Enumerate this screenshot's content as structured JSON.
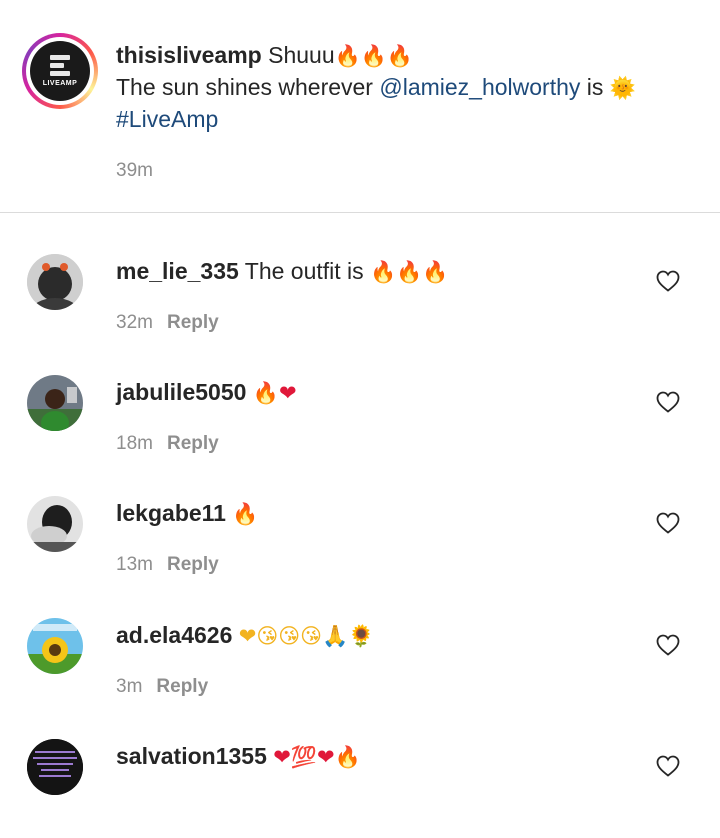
{
  "caption": {
    "username": "thisisliveamp",
    "line1_text": "Shuuu",
    "line1_emoji": "🔥🔥🔥",
    "line2_text": "The sun shines wherever",
    "mention": "@lamiez_holworthy",
    "line2_after": "is",
    "line2_emoji": "🌞",
    "hashtag": "#LiveAmp",
    "time": "39m",
    "avatar_logo_text": "LIVEAMP"
  },
  "comments": [
    {
      "username": "me_lie_335",
      "text": "The outfit is",
      "emoji": "🔥🔥🔥",
      "time": "32m",
      "reply": "Reply"
    },
    {
      "username": "jabulile5050",
      "text": "",
      "emoji": "🔥❤",
      "time": "18m",
      "reply": "Reply"
    },
    {
      "username": "lekgabe11",
      "text": "",
      "emoji": "🔥",
      "time": "13m",
      "reply": "Reply"
    },
    {
      "username": "ad.ela4626",
      "text": "",
      "emoji": "❤😘😘😘🙏🌻",
      "time": "3m",
      "reply": "Reply"
    },
    {
      "username": "salvation1355",
      "text": "",
      "emoji": "❤💯❤🔥",
      "time": "",
      "reply": ""
    }
  ],
  "colors": {
    "link": "#1e4a7a",
    "meta_gray": "#8e8e8e",
    "text": "#262626",
    "divider": "#dbdbdb"
  },
  "icons": [
    "heart-outline-icon",
    "liveamp-logo"
  ]
}
